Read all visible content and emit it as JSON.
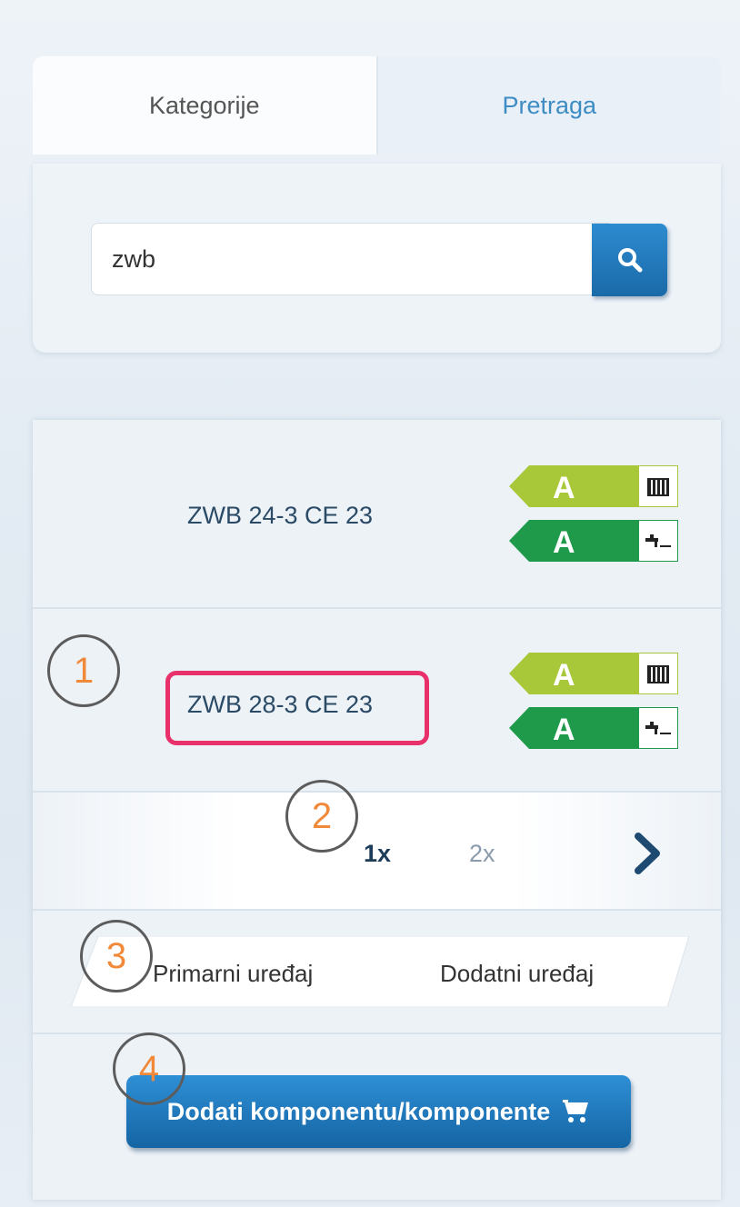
{
  "tabs": [
    {
      "label": "Kategorije",
      "active": true
    },
    {
      "label": "Pretraga",
      "active": false
    }
  ],
  "search": {
    "value": "zwb",
    "button_icon": "search-icon"
  },
  "results": [
    {
      "name": "ZWB 24-3 CE 23",
      "heating_class": "A",
      "water_class": "A"
    },
    {
      "name": "ZWB 28-3 CE 23",
      "heating_class": "A",
      "water_class": "A",
      "highlighted": true
    }
  ],
  "callouts": [
    "1",
    "2",
    "3",
    "4"
  ],
  "pagination": {
    "pages": [
      "1x",
      "2x"
    ],
    "current": "1x",
    "next_icon": "chevron-right-icon"
  },
  "device_type": {
    "options": [
      "Primarni uređaj",
      "Dodatni uređaj"
    ]
  },
  "add_button": {
    "label": "Dodati komponentu/komponente",
    "icon": "cart-icon"
  },
  "colors": {
    "accent_blue": "#1f78bd",
    "tab_active_text": "#555555",
    "tab_inactive_text": "#3d8cc4",
    "highlight": "#e8316a",
    "callout_number": "#f08a3a",
    "energy_heating": "#a8c83a",
    "energy_water": "#1e9a4a"
  }
}
